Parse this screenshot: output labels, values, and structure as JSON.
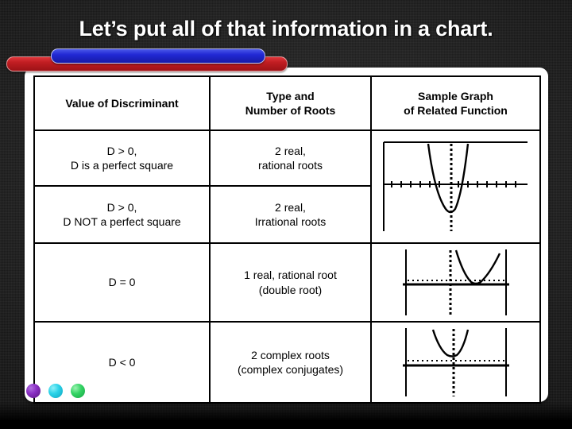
{
  "slide": {
    "title": "Let’s put all of that information in a chart.",
    "background_color": "#141414",
    "panel_color": "#ffffff",
    "accent_bar_red": "#c11d22",
    "accent_bar_blue": "#2128d4"
  },
  "table": {
    "headers": [
      "Value of Discriminant",
      "Type and\nNumber of Roots",
      "Sample Graph\nof Related Function"
    ],
    "headers_lines": {
      "col1": [
        "Value of Discriminant"
      ],
      "col2": [
        "Type and",
        "Number of Roots"
      ],
      "col3": [
        "Sample Graph",
        "of Related Function"
      ]
    },
    "rows": [
      {
        "discriminant_line1": "D > 0,",
        "discriminant_line2": "D is a perfect square",
        "roots_line1": "2 real,",
        "roots_line2": "rational roots",
        "graph": "parabola-two-x-intercepts"
      },
      {
        "discriminant_line1": "D > 0,",
        "discriminant_line2": "D NOT a perfect square",
        "roots_line1": "2 real,",
        "roots_line2": "Irrational roots",
        "graph": "parabola-two-x-intercepts-shared"
      },
      {
        "discriminant_line1": "D = 0",
        "discriminant_line2": "",
        "roots_line1": "1 real, rational root",
        "roots_line2": "(double root)",
        "graph": "parabola-tangent-to-x-axis"
      },
      {
        "discriminant_line1": "D < 0",
        "discriminant_line2": "",
        "roots_line1": "2 complex roots",
        "roots_line2": "(complex conjugates)",
        "graph": "parabola-above-x-axis"
      }
    ]
  },
  "decorations": {
    "dots": [
      {
        "name": "purple",
        "color": "#8a2fc4"
      },
      {
        "name": "cyan",
        "color": "#2ad2e8"
      },
      {
        "name": "green",
        "color": "#34d464"
      }
    ]
  }
}
